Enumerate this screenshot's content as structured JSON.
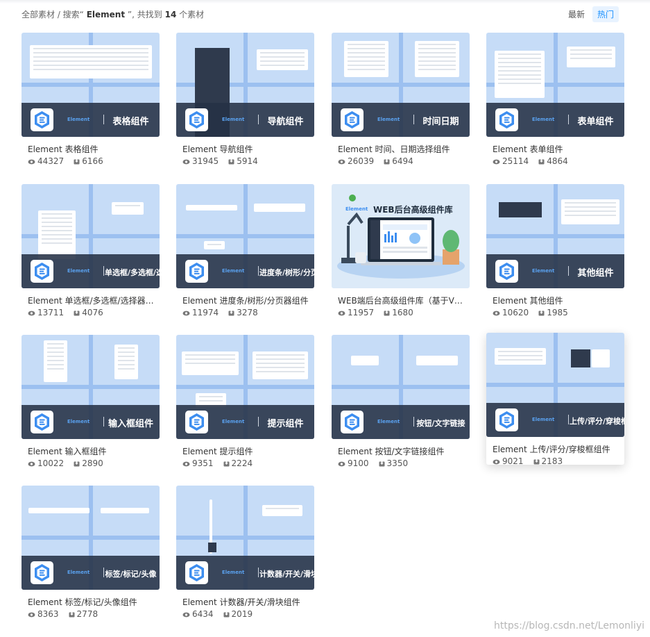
{
  "header": {
    "crumb_prefix": "全部素材 / 搜索“",
    "search_term": "Element",
    "crumb_middle": "”, 共找到",
    "result_count": "14",
    "crumb_suffix": "个素材",
    "sort_options": [
      {
        "label": "最新",
        "active": false
      },
      {
        "label": "热门",
        "active": true
      }
    ]
  },
  "band_word": "Element",
  "cards": [
    {
      "title": "Element 表格组件",
      "band": "表格组件",
      "views": "44327",
      "downloads": "6166"
    },
    {
      "title": "Element 导航组件",
      "band": "导航组件",
      "views": "31945",
      "downloads": "5914"
    },
    {
      "title": "Element 时间、日期选择组件",
      "band": "时间日期",
      "views": "26039",
      "downloads": "6494"
    },
    {
      "title": "Element 表单组件",
      "band": "表单组件",
      "views": "25114",
      "downloads": "4864"
    },
    {
      "title": "Element 单选框/多选框/选择器组...",
      "band": "单选框/多选框/选择器",
      "views": "13711",
      "downloads": "4076"
    },
    {
      "title": "Element 进度条/树形/分页器组件",
      "band": "进度条/树形/分页器",
      "views": "11974",
      "downloads": "3278"
    },
    {
      "title": "WEB端后台高级组件库（基于VU...",
      "band": "",
      "banner": "WEB后台高级组件库",
      "banner_logo": "Element",
      "views": "11957",
      "downloads": "1680"
    },
    {
      "title": "Element 其他组件",
      "band": "其他组件",
      "views": "10620",
      "downloads": "1985"
    },
    {
      "title": "Element 输入框组件",
      "band": "输入框组件",
      "views": "10022",
      "downloads": "2890"
    },
    {
      "title": "Element 提示组件",
      "band": "提示组件",
      "views": "9351",
      "downloads": "2224"
    },
    {
      "title": "Element 按钮/文字链接组件",
      "band": "按钮/文字链接",
      "views": "9100",
      "downloads": "3350"
    },
    {
      "title": "Element 上传/评分/穿梭框组件",
      "band": "上传/评分/穿梭框",
      "views": "9021",
      "downloads": "2183"
    },
    {
      "title": "Element 标签/标记/头像组件",
      "band": "标签/标记/头像",
      "views": "8363",
      "downloads": "2778"
    },
    {
      "title": "Element 计数器/开关/滑块组件",
      "band": "计数器/开关/滑块",
      "views": "6434",
      "downloads": "2019"
    }
  ],
  "watermark": "https://blog.csdn.net/Lemonliyi",
  "colors": {
    "accent": "#1890ff",
    "band": "#263146",
    "thumb_bg": "#c6dcf7",
    "grid_line": "#9cc0f0"
  },
  "icons": {
    "views": "eye-icon",
    "downloads": "download-box-icon",
    "logo": "element-logo-icon"
  }
}
